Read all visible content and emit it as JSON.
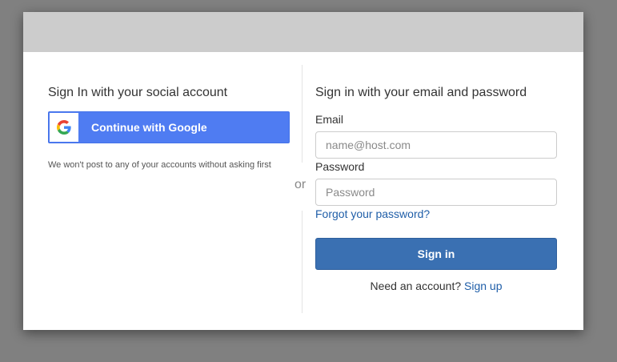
{
  "social": {
    "title": "Sign In with your social account",
    "google_button_label": "Continue with Google",
    "note": "We won't post to any of your accounts without asking first"
  },
  "divider": {
    "or_label": "or"
  },
  "credentials": {
    "title": "Sign in with your email and password",
    "email_label": "Email",
    "email_placeholder": "name@host.com",
    "email_value": "",
    "password_label": "Password",
    "password_placeholder": "Password",
    "password_value": "",
    "forgot_password_link": "Forgot your password?",
    "signin_button_label": "Sign in",
    "need_account_text": "Need an account?",
    "signup_link": "Sign up"
  },
  "colors": {
    "backdrop": "#808080",
    "header_bar": "#cccccc",
    "google_blue": "#4f7cf2",
    "signin_blue": "#3a70b2",
    "link_blue": "#1f5ea8"
  },
  "icons": {
    "google": "google-g-logo-icon"
  }
}
